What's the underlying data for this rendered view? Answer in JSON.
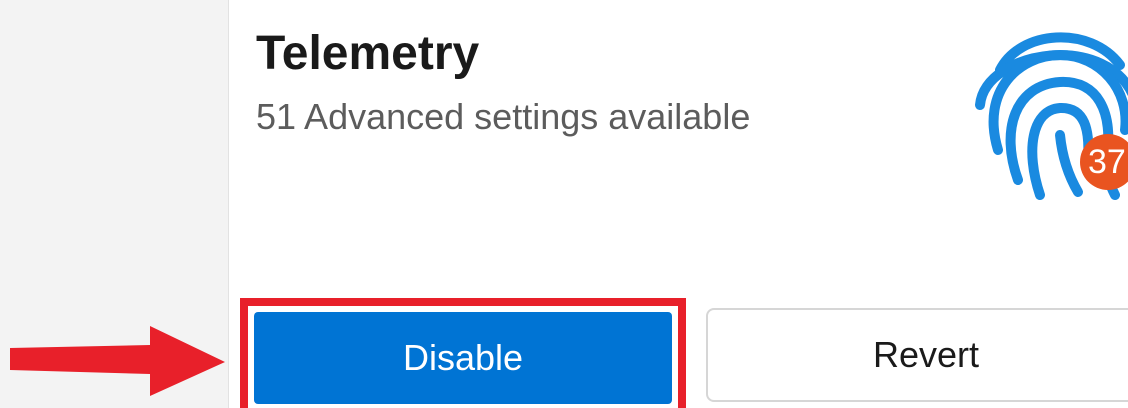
{
  "card": {
    "title": "Telemetry",
    "subtitle": "51 Advanced settings available",
    "icon": "fingerprint-icon",
    "badge_count": "37"
  },
  "actions": {
    "disable_label": "Disable",
    "revert_label": "Revert"
  },
  "annotation": {
    "arrow": "right-arrow-icon",
    "highlight": "highlight-box"
  },
  "colors": {
    "accent": "#0074d4",
    "badge": "#e95420",
    "annotation": "#e8202a",
    "fingerprint": "#1a8ae0"
  }
}
